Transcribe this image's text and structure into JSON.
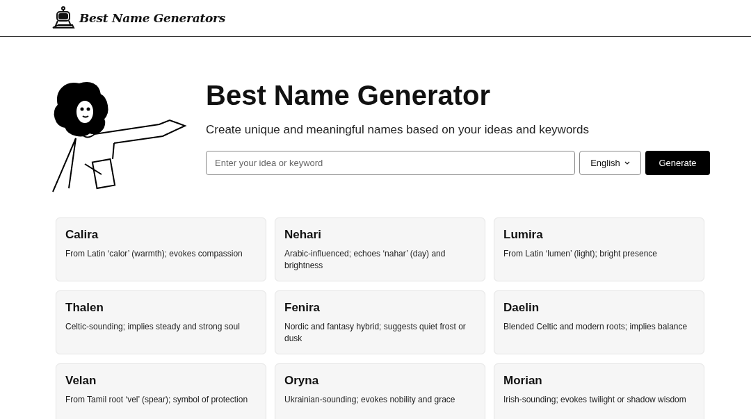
{
  "header": {
    "brand": "Best Name Generators"
  },
  "hero": {
    "title": "Best Name Generator",
    "subtitle": "Create unique and meaningful names based on your ideas and keywords",
    "input": {
      "placeholder": "Enter your idea or keyword"
    },
    "language": "English",
    "button": "Generate"
  },
  "names": [
    {
      "name": "Calira",
      "description": "From Latin ‘calor’ (warmth); evokes compassion"
    },
    {
      "name": "Nehari",
      "description": "Arabic-influenced; echoes ‘nahar’ (day) and brightness"
    },
    {
      "name": "Lumira",
      "description": "From Latin ‘lumen’ (light); bright presence"
    },
    {
      "name": "Thalen",
      "description": "Celtic-sounding; implies steady and strong soul"
    },
    {
      "name": "Fenira",
      "description": "Nordic and fantasy hybrid; suggests quiet frost or dusk"
    },
    {
      "name": "Daelin",
      "description": "Blended Celtic and modern roots; implies balance"
    },
    {
      "name": "Velan",
      "description": "From Tamil root ‘vel’ (spear); symbol of protection"
    },
    {
      "name": "Oryna",
      "description": "Ukrainian-sounding; evokes nobility and grace"
    },
    {
      "name": "Morian",
      "description": "Irish-sounding; evokes twilight or shadow wisdom"
    }
  ]
}
